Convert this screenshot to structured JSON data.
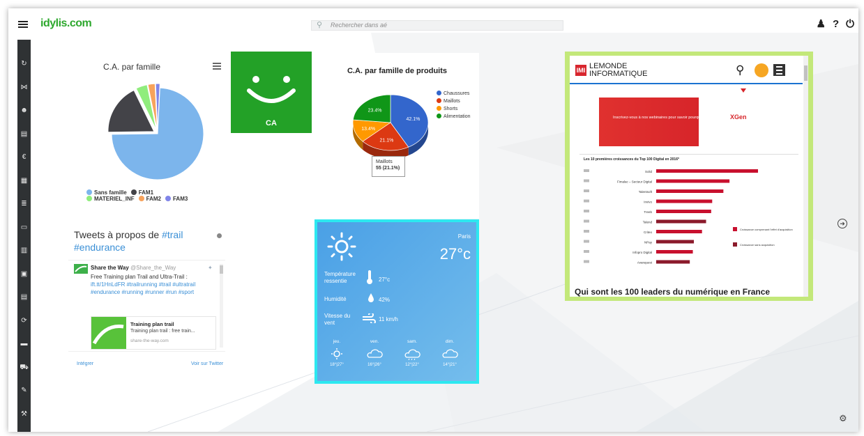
{
  "app": {
    "logo": "idylis.com",
    "search_placeholder": "Rechercher dans aé",
    "top_icons": [
      "users-settings-icon",
      "help-icon",
      "power-icon"
    ]
  },
  "rail_icons": [
    "refresh-icon",
    "network-icon",
    "contacts-icon",
    "documents-icon",
    "euro-icon",
    "calendar-icon",
    "stack-icon",
    "folder-icon",
    "layers-icon",
    "file-icon",
    "file-text-icon",
    "sync-icon",
    "folder-open-icon",
    "truck-icon",
    "wrench-icon",
    "tool-icon"
  ],
  "pie_widget": {
    "title": "C.A. par famille",
    "legend": [
      {
        "label": "Sans famille",
        "color": "#7cb5ec"
      },
      {
        "label": "FAM1",
        "color": "#434348"
      },
      {
        "label": "MATERIEL_INF",
        "color": "#90ed7d"
      },
      {
        "label": "FAM2",
        "color": "#f7a35c"
      },
      {
        "label": "FAM3",
        "color": "#8085e9"
      }
    ]
  },
  "ca_tile": {
    "label": "CA",
    "color": "#23a127"
  },
  "chart_data": {
    "type": "pie",
    "title": "C.A. par famille de produits",
    "categories": [
      "Chaussures",
      "Maillots",
      "Shorts",
      "Alimentation"
    ],
    "values": [
      42.1,
      21.1,
      13.4,
      23.4
    ],
    "value_labels": [
      "42.1%",
      "21.1%",
      "13.4%",
      "23.4%"
    ],
    "colors": [
      "#3366cc",
      "#dc3912",
      "#ff9900",
      "#109618"
    ],
    "tooltip": {
      "label": "Maillots",
      "value": "55 (21.1%)"
    },
    "legend_position": "top-right"
  },
  "tweets": {
    "title_prefix": "Tweets à propos de",
    "tag1": "#trail",
    "tag2": "#endurance",
    "author_name": "Share the Way",
    "author_handle": "@Share_the_Way",
    "text_plain": "Free Training plan Trail and Ultra-Trail :",
    "text_links": "ift.tt/1HnLdFR #trailrunning #trail #ultratrail #endurance #running #runner #run #sport",
    "preview_title": "Training plan trail",
    "preview_desc": "Training plan trail : free train...",
    "preview_url": "share-the-way.com",
    "embed_label": "Intégrer",
    "view_label": "Voir sur Twitter"
  },
  "weather": {
    "city": "Paris",
    "temp": "27°c",
    "feels_label": "Température ressentie",
    "feels_value": "27°c",
    "humidity_label": "Humidité",
    "humidity_value": "42%",
    "wind_label": "Vitesse du vent",
    "wind_value": "11 km/h",
    "forecast": [
      {
        "day": "jeu.",
        "range": "18°|27°",
        "icon": "sun-icon"
      },
      {
        "day": "ven.",
        "range": "16°|26°",
        "icon": "cloud-icon"
      },
      {
        "day": "sam.",
        "range": "12°|22°",
        "icon": "rain-icon"
      },
      {
        "day": "dim.",
        "range": "14°|21°",
        "icon": "cloud-icon"
      }
    ]
  },
  "news": {
    "brand_line1": "LEMONDE",
    "brand_line2": "INFORMATIQUE",
    "logo_letters": "IMI",
    "ad_text": "Inscrivez-vous à nos webinaires pour savoir pourquoi",
    "ad_brand": "XGen",
    "chart_title": "Les 10 premières croissances du Top 100 Digital en 2016*",
    "chart_rows": [
      "Solid",
      "Fimalac – Secteur Digital",
      "Talentsoft",
      "Invivo",
      "Treeb",
      "Talend",
      "Criteo",
      "NPay",
      "Infopro Digital",
      "Avanquest"
    ],
    "chart_values": [
      100,
      72,
      66,
      55,
      54,
      49,
      45,
      37,
      36,
      33
    ],
    "chart_legend": [
      "Croissance comprenant l'effet d'acquisition",
      "Croissance sans acquisition"
    ],
    "headline": "Qui sont les 100 leaders du numérique en France"
  }
}
